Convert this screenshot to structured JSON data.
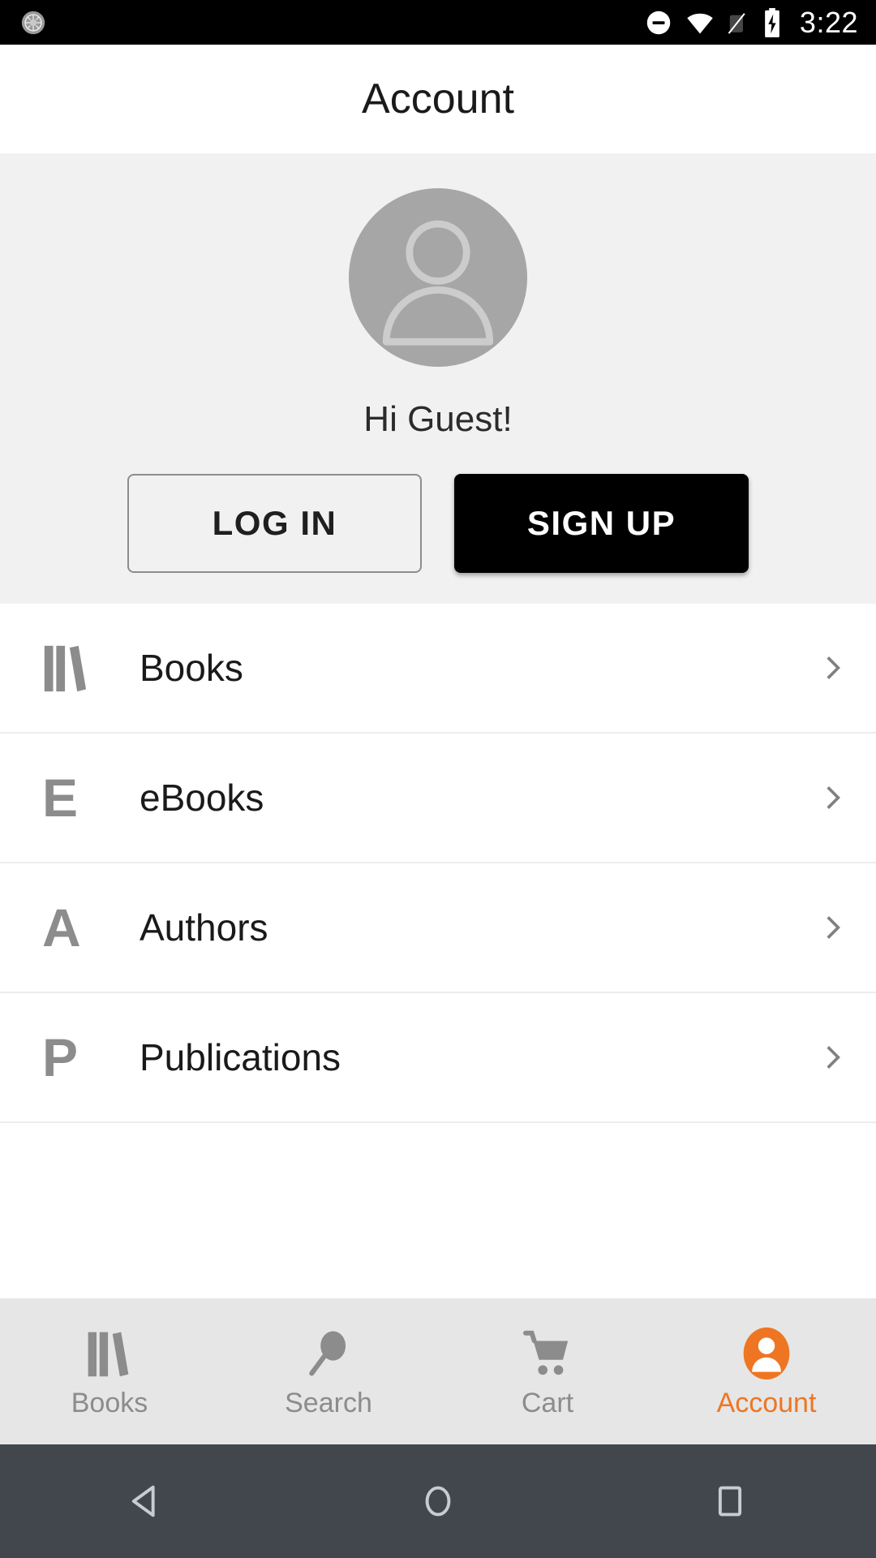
{
  "status_bar": {
    "left_icon": "sync-circle-icon",
    "icons": [
      "do-not-disturb-icon",
      "wifi-icon",
      "cellular-off-icon",
      "battery-charging-icon"
    ],
    "time": "3:22"
  },
  "header": {
    "title": "Account"
  },
  "profile": {
    "avatar_icon": "person-placeholder-icon",
    "greeting": "Hi Guest!",
    "login_label": "LOG IN",
    "signup_label": "SIGN UP"
  },
  "menu": {
    "items": [
      {
        "label": "Books",
        "icon": "books-icon",
        "chevron": "chevron-right-icon"
      },
      {
        "label": "eBooks",
        "icon": "letter-e-icon",
        "letter": "E",
        "chevron": "chevron-right-icon"
      },
      {
        "label": "Authors",
        "icon": "letter-a-icon",
        "letter": "A",
        "chevron": "chevron-right-icon"
      },
      {
        "label": "Publications",
        "icon": "letter-p-icon",
        "letter": "P",
        "chevron": "chevron-right-icon"
      }
    ]
  },
  "tab_bar": {
    "active": "Account",
    "tabs": [
      {
        "label": "Books",
        "icon": "books-icon"
      },
      {
        "label": "Search",
        "icon": "search-icon"
      },
      {
        "label": "Cart",
        "icon": "cart-icon"
      },
      {
        "label": "Account",
        "icon": "account-icon"
      }
    ]
  },
  "nav_bar": {
    "back": "back-triangle-icon",
    "home": "home-circle-icon",
    "recents": "recents-square-icon"
  },
  "colors": {
    "accent": "#ee7623",
    "card_bg": "#f1f1f1",
    "tab_bg": "#e6e6e6",
    "nav_bg": "#41474d",
    "icon_gray": "#8c8c8c",
    "avatar_gray": "#a6a6a6"
  }
}
